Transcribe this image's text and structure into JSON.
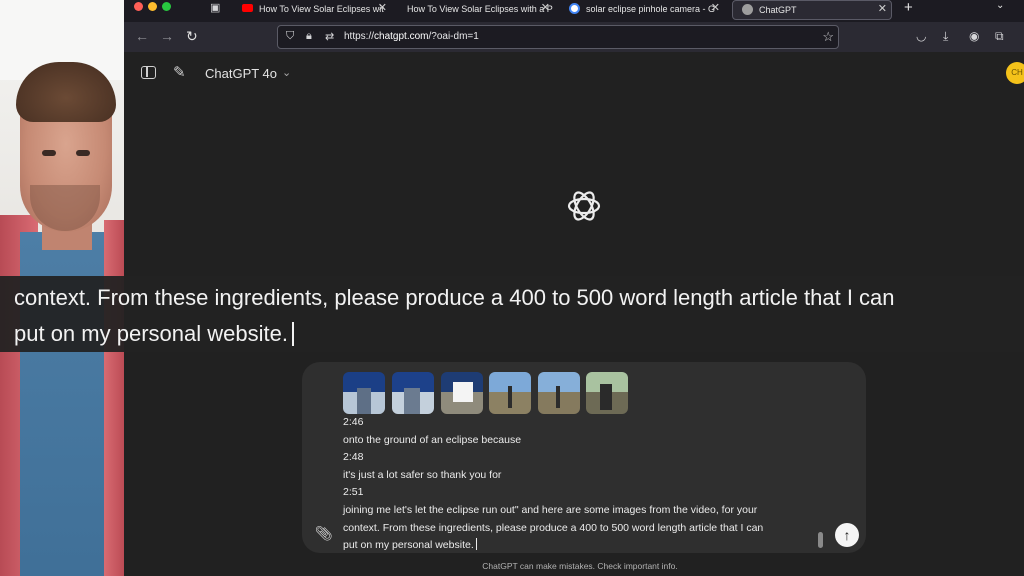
{
  "tabs": [
    {
      "label": "How To View Solar Eclipses wit",
      "icon": "youtube-icon",
      "color": "#ff0000"
    },
    {
      "label": "How To View Solar Eclipses with a P",
      "icon": "none",
      "color": ""
    },
    {
      "label": "solar eclipse pinhole camera - G",
      "icon": "google-icon",
      "color": "#4285f4"
    },
    {
      "label": "ChatGPT",
      "icon": "chatgpt-icon",
      "color": "#9e9e9e"
    }
  ],
  "url": {
    "prefix": "https://",
    "host": "chatgpt.com",
    "path": "/?oai-dm=1"
  },
  "app": {
    "model_label": "ChatGPT 4o",
    "avatar_initials": "CH",
    "caption_lines": [
      "context. From these ingredients, please produce a 400 to 500 word length article that I can",
      "put on my personal website."
    ],
    "composer_lines": [
      "2:46",
      "onto the ground of an eclipse because",
      "2:48",
      "it's just a lot safer so thank you for",
      "2:51",
      "joining me let's let the eclipse run out\" and here are some images from the video, for your",
      "context. From these ingredients, please produce a 400 to 500 word length article that I can",
      "put on my personal website."
    ],
    "disclaimer": "ChatGPT can make mistakes. Check important info."
  },
  "colors": {
    "accent": "#f4c21a",
    "background": "#212121",
    "composer": "#2f2f2f"
  }
}
